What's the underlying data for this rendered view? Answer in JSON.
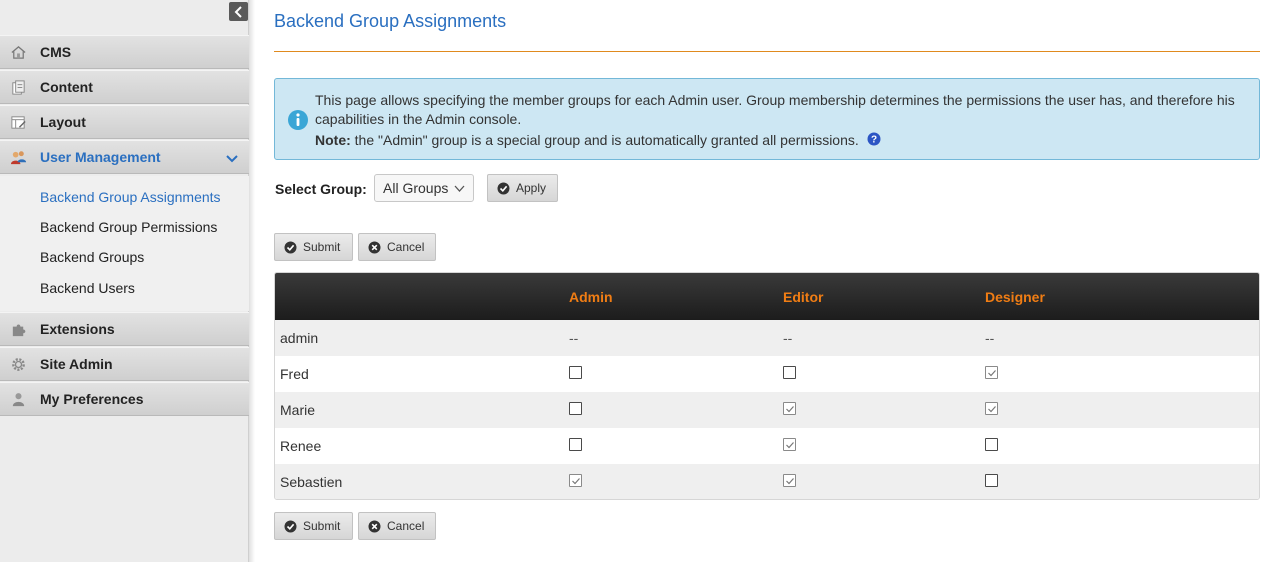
{
  "sidebar": {
    "nav": [
      {
        "label": "CMS",
        "icon": "home-icon"
      },
      {
        "label": "Content",
        "icon": "content-icon"
      },
      {
        "label": "Layout",
        "icon": "layout-icon"
      },
      {
        "label": "User Management",
        "icon": "users-icon"
      },
      {
        "label": "Extensions",
        "icon": "puzzle-icon"
      },
      {
        "label": "Site Admin",
        "icon": "gear-icon"
      },
      {
        "label": "My Preferences",
        "icon": "user-icon"
      }
    ],
    "submenu": [
      {
        "label": "Backend Group Assignments"
      },
      {
        "label": "Backend Group Permissions"
      },
      {
        "label": "Backend Groups"
      },
      {
        "label": "Backend Users"
      }
    ],
    "active_nav": "User Management",
    "active_sub": "Backend Group Assignments"
  },
  "main": {
    "title": "Backend Group Assignments",
    "info": {
      "text": "This page allows specifying the member groups for each Admin user. Group membership determines the permissions the user has, and therefore his capabilities in the Admin console.",
      "note_label": "Note:",
      "note_text": "the \"Admin\" group is a special group and is automatically granted all permissions."
    },
    "select_group": {
      "label": "Select Group:",
      "value": "All Groups"
    },
    "apply_label": "Apply",
    "submit_label": "Submit",
    "cancel_label": "Cancel",
    "table": {
      "columns": [
        "Admin",
        "Editor",
        "Designer"
      ],
      "rows": [
        {
          "name": "admin",
          "cells": [
            "--",
            "--",
            "--"
          ]
        },
        {
          "name": "Fred",
          "cells": [
            false,
            false,
            true
          ]
        },
        {
          "name": "Marie",
          "cells": [
            false,
            true,
            true
          ]
        },
        {
          "name": "Renee",
          "cells": [
            false,
            true,
            false
          ]
        },
        {
          "name": "Sebastien",
          "cells": [
            true,
            true,
            false
          ]
        }
      ]
    }
  },
  "colors": {
    "accent_blue": "#2a6fc0",
    "header_orange": "#f07d14",
    "rule_orange": "#e08a1e",
    "info_bg": "#cde7f3"
  }
}
